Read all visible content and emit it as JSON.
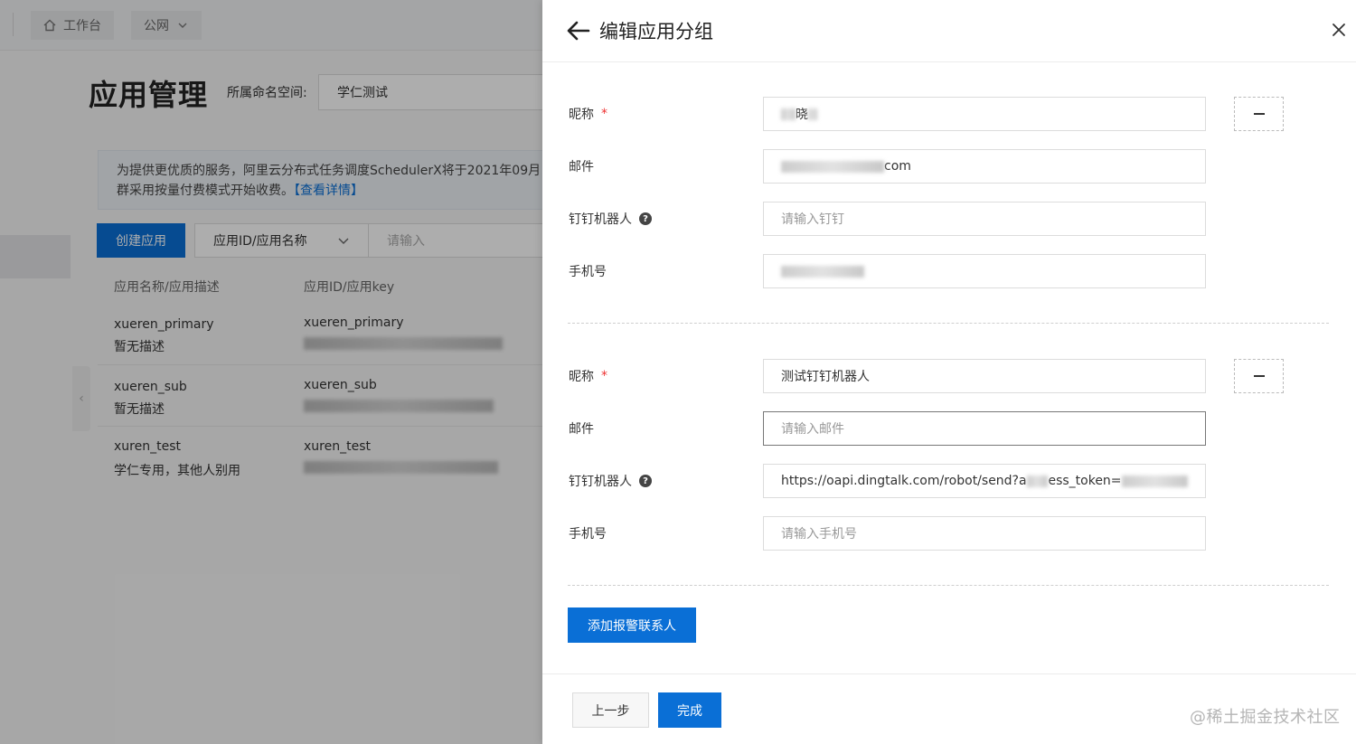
{
  "topbar": {
    "workbench_label": "工作台",
    "network_label": "公网"
  },
  "page": {
    "title": "应用管理",
    "namespace_label": "所属命名空间:",
    "namespace_value": "学仁测试",
    "notice_line1": "为提供更优质的服务，阿里云分布式任务调度SchedulerX将于2021年09月",
    "notice_line2": "群采用按量付费模式开始收费。",
    "notice_link": "【查看详情】",
    "create_button": "创建应用",
    "filter_select": "应用ID/应用名称",
    "filter_placeholder": "请输入",
    "table": {
      "headers": [
        "应用名称/应用描述",
        "应用ID/应用key"
      ],
      "rows": [
        {
          "name": "xueren_primary",
          "desc": "暂无描述",
          "app_id": "xueren_primary"
        },
        {
          "name": "xueren_sub",
          "desc": "暂无描述",
          "app_id": "xueren_sub"
        },
        {
          "name": "xuren_test",
          "desc": "学仁专用，其他人别用",
          "app_id": "xuren_test"
        }
      ]
    }
  },
  "drawer": {
    "title": "编辑应用分组",
    "contacts": [
      {
        "nickname_label": "昵称",
        "nickname_value": "晓",
        "email_label": "邮件",
        "email_value": "com",
        "ding_label": "钉钉机器人",
        "ding_placeholder": "请输入钉钉",
        "phone_label": "手机号",
        "phone_value": ""
      },
      {
        "nickname_label": "昵称",
        "nickname_value": "测试钉钉机器人",
        "email_label": "邮件",
        "email_placeholder": "请输入邮件",
        "ding_label": "钉钉机器人",
        "ding_value": "https://oapi.dingtalk.com/robot/send?a",
        "ding_value_tail": "ess_token=",
        "phone_label": "手机号",
        "phone_placeholder": "请输入手机号"
      }
    ],
    "add_contact_button": "添加报警联系人",
    "prev_button": "上一步",
    "done_button": "完成",
    "watermark": "@稀土掘金技术社区"
  },
  "colors": {
    "primary": "#0a6fd6",
    "required": "#ee3333"
  }
}
